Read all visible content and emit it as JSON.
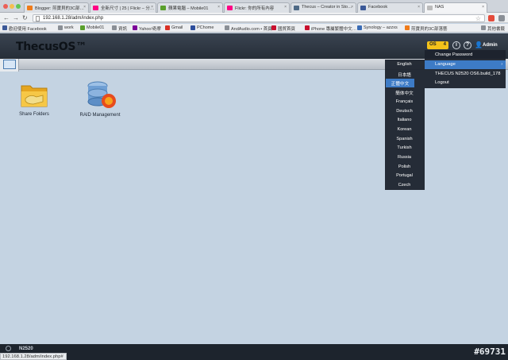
{
  "browser": {
    "tabs": [
      {
        "label": "Blogger: 煎寶貝的3C部…",
        "color": "#f07b1a"
      },
      {
        "label": "全新尺寸 | 25 | Flickr – 分…",
        "color": "#ff0084"
      },
      {
        "label": "蘋果電腦 – Mobile01",
        "color": "#5aa02c"
      },
      {
        "label": "Flickr: 你的所有內容",
        "color": "#ff0084"
      },
      {
        "label": "Thecus – Creator in Sto…",
        "color": "#4f6a86"
      },
      {
        "label": "Facebook",
        "color": "#3b5998"
      },
      {
        "label": "NAS",
        "color": "#bbbbbb"
      }
    ],
    "url": "192.168.1.28/adm/index.php",
    "bookmarks": [
      {
        "label": "歡迎使用 Facebook",
        "color": "#3b5998"
      },
      {
        "label": "work",
        "color": "#8a8f96"
      },
      {
        "label": "Mobile01",
        "color": "#5aa02c"
      },
      {
        "label": "資訊",
        "color": "#8a8f96"
      },
      {
        "label": "Yahoo!奇摩",
        "color": "#7b0099"
      },
      {
        "label": "Gmail",
        "color": "#d93025"
      },
      {
        "label": "PChome",
        "color": "#2c4d9c"
      },
      {
        "label": "AndAudio.com • 首頁",
        "color": "#8a8f96"
      },
      {
        "label": "國貿首頁",
        "color": "#c8102e"
      },
      {
        "label": "iPhone 專屬繁體中文…",
        "color": "#c8102e"
      },
      {
        "label": "Synology – azzxs",
        "color": "#3a6cb5"
      },
      {
        "label": "煎寶貝的3C部落藝",
        "color": "#f07b1a"
      },
      {
        "label": "其他書籤",
        "color": "#8a8f96"
      }
    ],
    "status_url": "192.168.1.28/adm/index.php#"
  },
  "app": {
    "logo": "ThecusOS™",
    "os_badge": "OS",
    "os_badge_num": "4",
    "info_symbol": "i",
    "help_symbol": "?",
    "admin_label": "Admin",
    "nas_name": "N2520"
  },
  "desktop": [
    {
      "label": "Share Folders"
    },
    {
      "label": "RAID Management"
    }
  ],
  "admin_menu": [
    {
      "label": "Change Password"
    },
    {
      "label": "Language"
    },
    {
      "label": "THECUS N2520 OS6.build_178"
    },
    {
      "label": "Logout"
    }
  ],
  "languages": [
    "English",
    "日本語",
    "正體中文",
    "簡体中文",
    "Français",
    "Deutsch",
    "Italiano",
    "Korean",
    "Spanish",
    "Turkish",
    "Russia",
    "Polish",
    "Portugal",
    "Czech"
  ],
  "selected_language": "正體中文",
  "watermark": "#69731"
}
